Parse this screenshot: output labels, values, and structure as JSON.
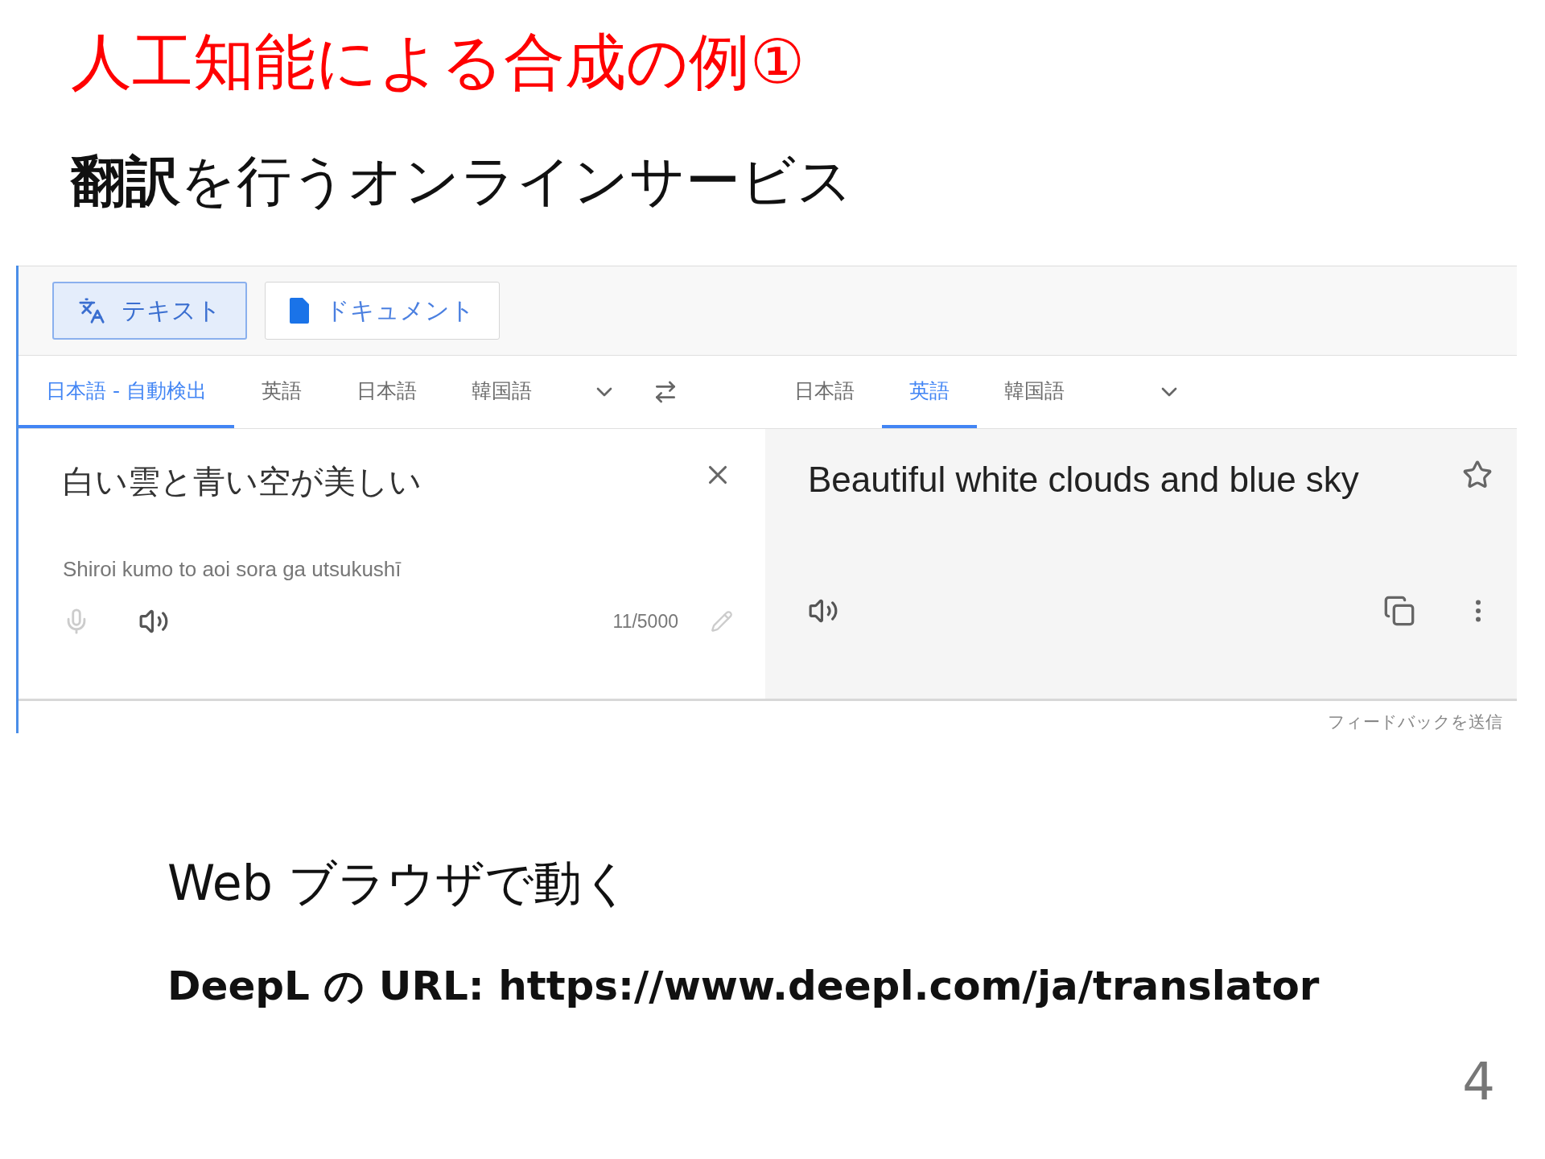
{
  "slide": {
    "title": "人工知能による合成の例①",
    "subtitle": "**翻訳**を行うオンラインサービス",
    "page_number": "4"
  },
  "translator": {
    "mode_buttons": [
      {
        "kind": "text",
        "label": "テキスト",
        "selected": true
      },
      {
        "kind": "document",
        "label": "ドキュメント",
        "selected": false
      }
    ],
    "source_languages": [
      {
        "label": "日本語 - 自動検出",
        "selected": true
      },
      {
        "label": "英語",
        "selected": false
      },
      {
        "label": "日本語",
        "selected": false
      },
      {
        "label": "韓国語",
        "selected": false
      }
    ],
    "target_languages": [
      {
        "label": "日本語",
        "selected": false
      },
      {
        "label": "英語",
        "selected": true
      },
      {
        "label": "韓国語",
        "selected": false
      }
    ],
    "source_text": "白い雲と青い空が美しい",
    "romanization": "Shiroi kumo to aoi sora ga utsukushī",
    "char_count": "11/5000",
    "translation": "Beautiful white clouds and blue sky",
    "feedback_link": "フィードバックを送信"
  },
  "notes": [
    {
      "kind": "plain",
      "text": "Web ブラウザで動く"
    },
    {
      "kind": "bold",
      "text": "DeepL の URL: https://www.deepl.com/ja/translator"
    }
  ]
}
